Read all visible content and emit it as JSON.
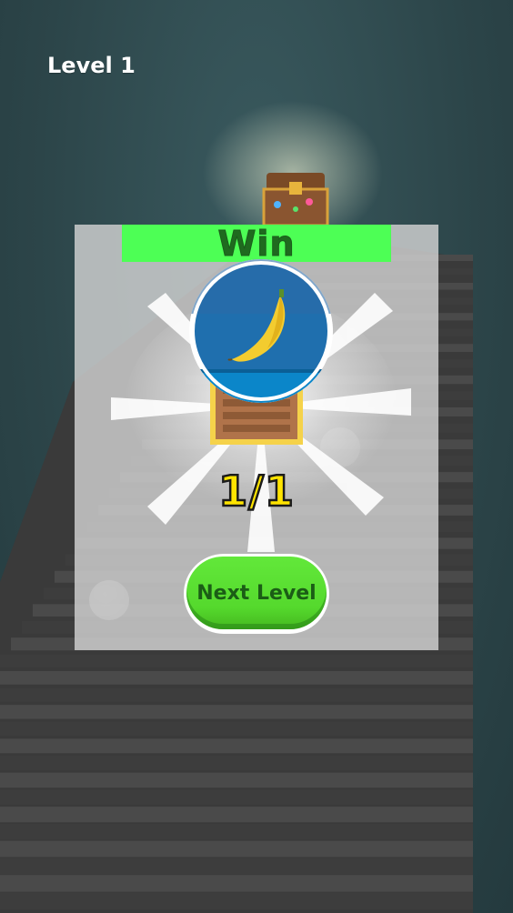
{
  "hud": {
    "level_label": "Level 1"
  },
  "win_panel": {
    "title": "Win",
    "reward_icon": "banana-icon",
    "progress_text": "1/1",
    "next_button_label": "Next Level"
  },
  "colors": {
    "win_bar": "#4dff55",
    "win_text": "#1f6a1f",
    "progress_text": "#ffe400",
    "next_button": "#55d92d",
    "background": "#2e4a4f"
  }
}
